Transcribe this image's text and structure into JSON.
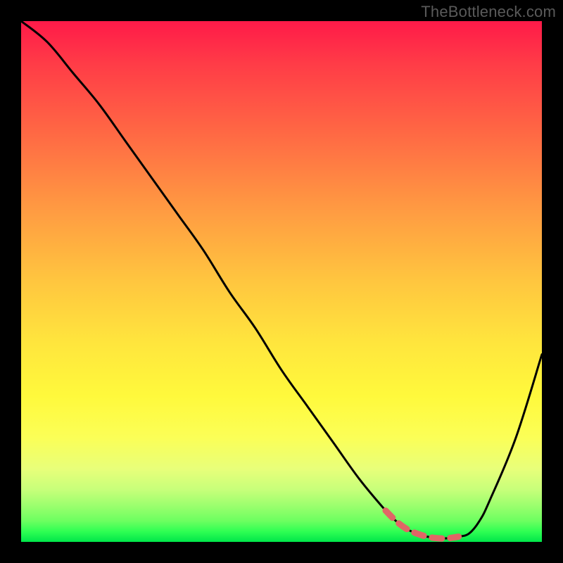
{
  "watermark": "TheBottleneck.com",
  "colors": {
    "background": "#000000",
    "curve_main": "#000000",
    "curve_highlight": "#e06666",
    "gradient_top": "#ff1a49",
    "gradient_bottom": "#00e64a"
  },
  "chart_data": {
    "type": "line",
    "title": "",
    "xlabel": "",
    "ylabel": "",
    "xlim": [
      0,
      100
    ],
    "ylim": [
      0,
      100
    ],
    "grid": false,
    "legend": false,
    "annotations": [
      "TheBottleneck.com"
    ],
    "series": [
      {
        "name": "bottleneck-curve",
        "x": [
          0,
          5,
          10,
          15,
          20,
          25,
          30,
          35,
          40,
          45,
          50,
          55,
          60,
          65,
          70,
          72,
          74,
          76,
          78,
          80,
          82,
          84,
          86,
          88,
          90,
          95,
          100
        ],
        "values": [
          100,
          96,
          90,
          84,
          77,
          70,
          63,
          56,
          48,
          41,
          33,
          26,
          19,
          12,
          6,
          4,
          2.5,
          1.6,
          1.0,
          0.7,
          0.7,
          1.0,
          1.6,
          4,
          8,
          20,
          36
        ]
      },
      {
        "name": "optimal-flat-region",
        "x": [
          70,
          72,
          74,
          76,
          78,
          80,
          82,
          84
        ],
        "values": [
          6.0,
          4.0,
          2.5,
          1.6,
          1.0,
          0.7,
          0.7,
          1.0
        ]
      }
    ]
  }
}
